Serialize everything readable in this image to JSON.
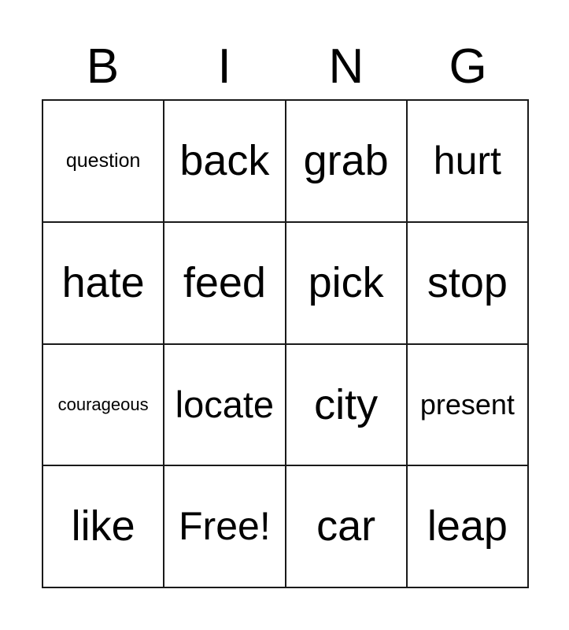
{
  "card": {
    "header_letters": [
      "B",
      "I",
      "N",
      "G"
    ],
    "columns": 4,
    "rows": 4,
    "free_space_label": "Free!",
    "border_color": "#1a1a1a",
    "background_color": "#ffffff",
    "text_color": "#000000",
    "cells": [
      {
        "text": "question",
        "size": "xs",
        "row": 1,
        "col": 1,
        "free": false
      },
      {
        "text": "back",
        "size": "xl",
        "row": 1,
        "col": 2,
        "free": false
      },
      {
        "text": "grab",
        "size": "xl",
        "row": 1,
        "col": 3,
        "free": false
      },
      {
        "text": "hurt",
        "size": "lg",
        "row": 1,
        "col": 4,
        "free": false
      },
      {
        "text": "hate",
        "size": "xl",
        "row": 2,
        "col": 1,
        "free": false
      },
      {
        "text": "feed",
        "size": "xl",
        "row": 2,
        "col": 2,
        "free": false
      },
      {
        "text": "pick",
        "size": "xl",
        "row": 2,
        "col": 3,
        "free": false
      },
      {
        "text": "stop",
        "size": "xl",
        "row": 2,
        "col": 4,
        "free": false
      },
      {
        "text": "courageous",
        "size": "xxs",
        "row": 3,
        "col": 1,
        "free": false
      },
      {
        "text": "locate",
        "size": "md",
        "row": 3,
        "col": 2,
        "free": false
      },
      {
        "text": "city",
        "size": "xl",
        "row": 3,
        "col": 3,
        "free": false
      },
      {
        "text": "present",
        "size": "sm",
        "row": 3,
        "col": 4,
        "free": false
      },
      {
        "text": "like",
        "size": "xl",
        "row": 4,
        "col": 1,
        "free": false
      },
      {
        "text": "Free!",
        "size": "lg",
        "row": 4,
        "col": 2,
        "free": true
      },
      {
        "text": "car",
        "size": "xl",
        "row": 4,
        "col": 3,
        "free": false
      },
      {
        "text": "leap",
        "size": "xl",
        "row": 4,
        "col": 4,
        "free": false
      }
    ]
  }
}
